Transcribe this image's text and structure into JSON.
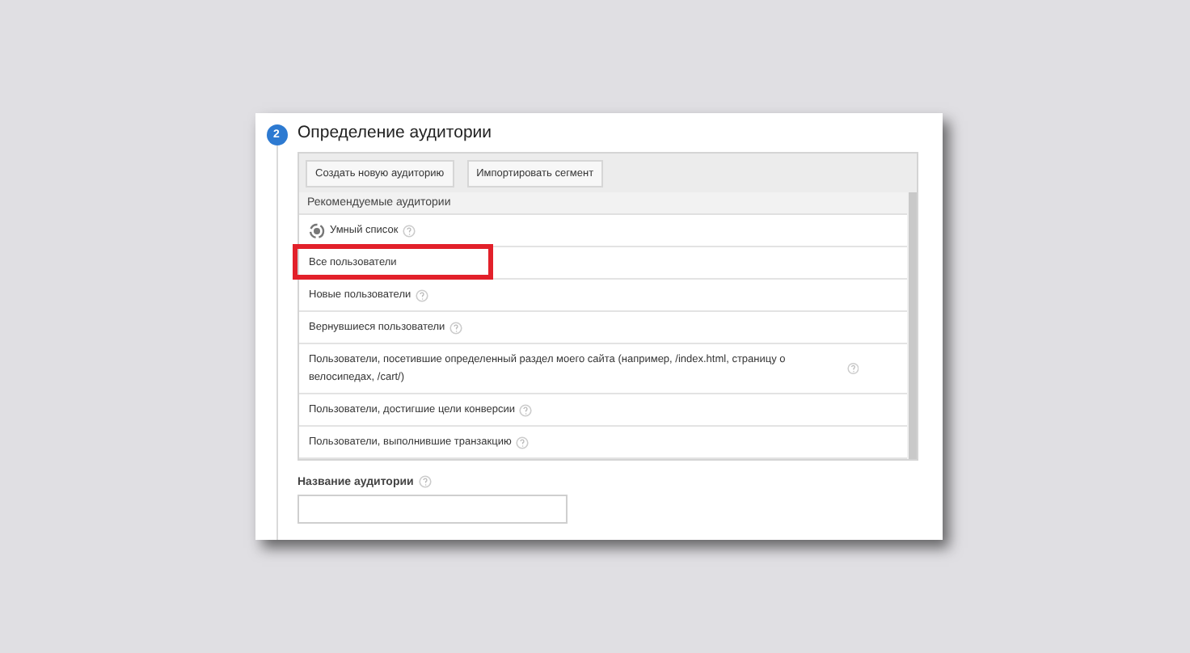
{
  "step": {
    "number": "2",
    "title": "Определение аудитории"
  },
  "buttons": [
    "Создать новую аудиторию",
    "Импортировать сегмент"
  ],
  "list_header": "Рекомендуемые аудитории",
  "audiences": [
    {
      "label": "Умный список",
      "kind": "smart",
      "highlighted": false
    },
    {
      "label": "Все пользователи",
      "kind": "plain",
      "highlighted": true
    },
    {
      "label": "Новые пользователи",
      "kind": "help",
      "highlighted": false
    },
    {
      "label": "Вернувшиеся пользователи",
      "kind": "help",
      "highlighted": false
    },
    {
      "label": "Пользователи, посетившие определенный раздел моего сайта (например, /index.html, страницу о велосипедах, /cart/)",
      "kind": "help",
      "highlighted": false
    },
    {
      "label": "Пользователи, достигшие цели конверсии",
      "kind": "help",
      "highlighted": false
    },
    {
      "label": "Пользователи, выполнившие транзакцию",
      "kind": "help",
      "highlighted": false
    }
  ],
  "name_field": {
    "label": "Название аудитории"
  }
}
